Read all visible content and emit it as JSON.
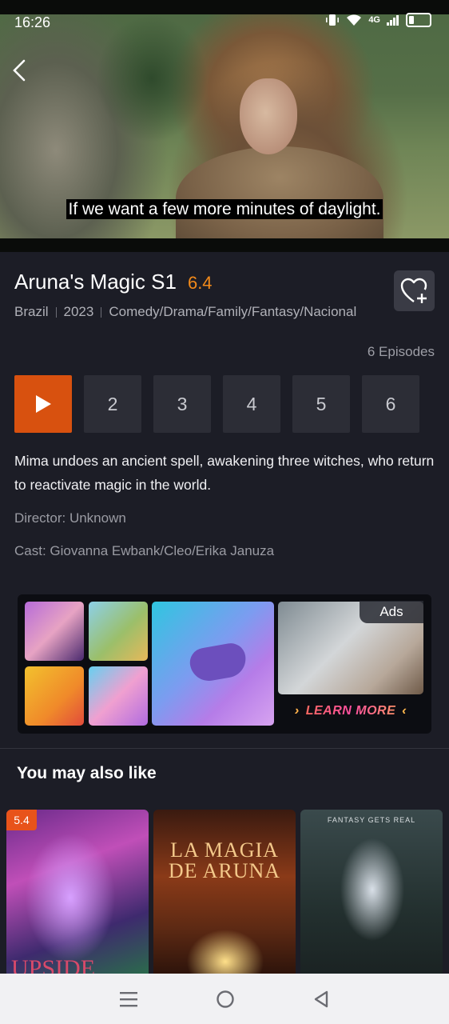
{
  "status_bar": {
    "time": "16:26",
    "network": "4G"
  },
  "video": {
    "subtitle": "If we want a few more minutes of daylight."
  },
  "show": {
    "title": "Aruna's Magic S1",
    "rating": "6.4",
    "country": "Brazil",
    "year": "2023",
    "genres": "Comedy/Drama/Family/Fantasy/Nacional",
    "episodes_count": "6 Episodes",
    "episodes": [
      "2",
      "3",
      "4",
      "5",
      "6"
    ],
    "description": "Mima undoes an ancient spell, awakening three witches, who return to reactivate magic in the world.",
    "director": "Director: Unknown",
    "cast": "Cast: Giovanna Ewbank/Cleo/Erika Januza"
  },
  "ad": {
    "badge": "Ads",
    "cta": "LEARN MORE"
  },
  "recommendations": {
    "title": "You may also like",
    "items": [
      {
        "rating": "5.4",
        "poster_text": "UPSIDE"
      },
      {
        "poster_text": "LA MAGIA DE ARUNA"
      },
      {
        "poster_text": "FANTASY GETS REAL"
      }
    ]
  },
  "colors": {
    "accent": "#d8510f",
    "rating": "#f28a1a",
    "background": "#1c1d26"
  }
}
